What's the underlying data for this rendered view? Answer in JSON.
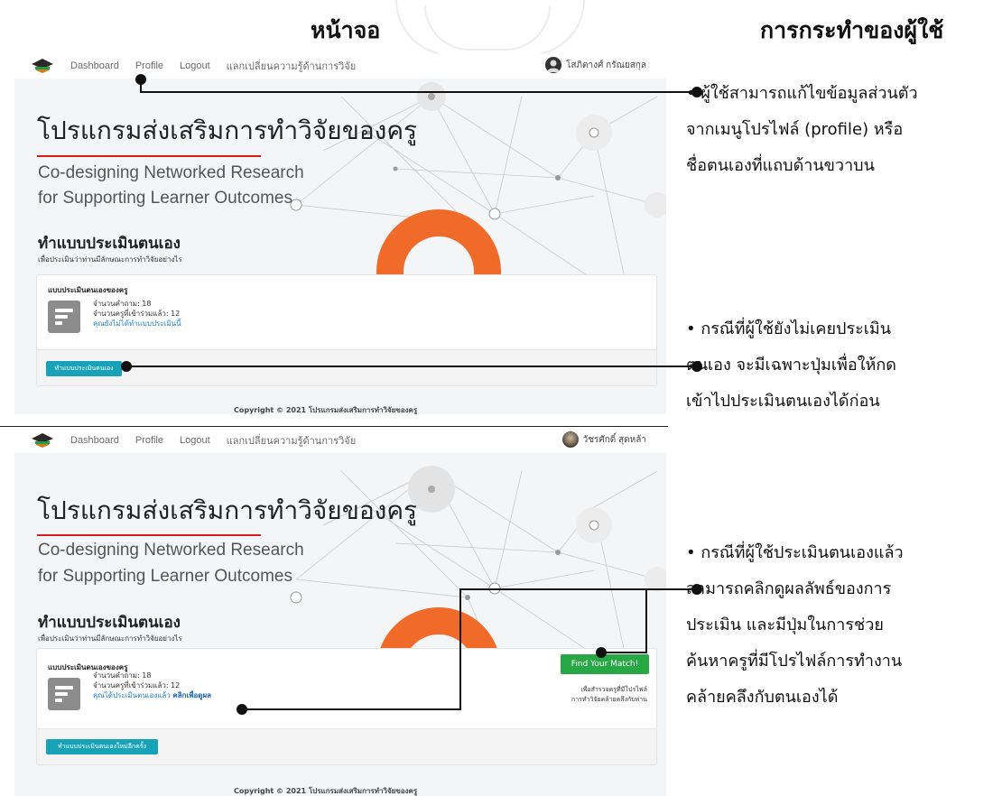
{
  "columns": {
    "screen_label": "หน้าจอ",
    "action_label": "การกระทำของผู้ใช้"
  },
  "screen1": {
    "nav": {
      "dashboard": "Dashboard",
      "profile": "Profile",
      "logout": "Logout",
      "exchange": "แลกเปลี่ยนความรู้ด้านการวิจัย",
      "user_name": "โสภิตางศ์ กรัณยสกุล"
    },
    "hero": {
      "title": "โปรแกรมส่งเสริมการทำวิจัยของครู",
      "subtitle_line1": "Co-designing Networked Research",
      "subtitle_line2": "for Supporting Learner Outcomes"
    },
    "section": {
      "title": "ทำแบบประเมินตนเอง",
      "subtitle": "เพื่อประเมินว่าท่านมีลักษณะการทำวิจัยอย่างไร"
    },
    "card": {
      "title": "แบบประเมินตนเองของครู",
      "questions": "จำนวนคำถาม: 18",
      "participants": "จำนวนครูที่เข้าร่วมแล้ว: 12",
      "status": "คุณยังไม่ได้ทำแบบประเมินนี้",
      "button": "ทำแบบประเมินตนเอง"
    },
    "copyright": "Copyright © 2021 โปรแกรมส่งเสริมการทำวิจัยของครู"
  },
  "screen2": {
    "nav": {
      "dashboard": "Dashboard",
      "profile": "Profile",
      "logout": "Logout",
      "exchange": "แลกเปลี่ยนความรู้ด้านการวิจัย",
      "user_name": "วัชรศักดิ์ สุดหล้า"
    },
    "hero": {
      "title": "โปรแกรมส่งเสริมการทำวิจัยของครู",
      "subtitle_line1": "Co-designing Networked Research",
      "subtitle_line2": "for Supporting Learner Outcomes"
    },
    "section": {
      "title": "ทำแบบประเมินตนเอง",
      "subtitle": "เพื่อประเมินว่าท่านมีลักษณะการทำวิจัยอย่างไร"
    },
    "card": {
      "title": "แบบประเมินตนเองของครู",
      "questions": "จำนวนคำถาม: 18",
      "participants": "จำนวนครูที่เข้าร่วมแล้ว: 12",
      "status_text": "คุณได้ประเมินตนเองแล้ว",
      "status_link": "คลิกเพื่อดูผล",
      "button": "ทำแบบประเมินตนเองใหม่อีกครั้ง",
      "match_button": "Find Your Match!",
      "match_note_line1": "เพื่อสำรวจครูที่มีโปรไฟล์",
      "match_note_line2": "การทำวิจัยคล้ายคลึงกับท่าน"
    },
    "copyright": "Copyright © 2021 โปรแกรมส่งเสริมการทำวิจัยของครู"
  },
  "annotations": {
    "a1": [
      "• ผู้ใช้สามารถแก้ไขข้อมูลส่วนตัว",
      "จากเมนูโปรไฟล์ (profile) หรือ",
      "ชื่อตนเองที่แถบด้านขวาบน"
    ],
    "a2": [
      "• กรณีที่ผู้ใช้ยังไม่เคยประเมิน",
      "ตนเอง จะมีเฉพาะปุ่มเพื่อให้กด",
      "เข้าไปประเมินตนเองได้ก่อน"
    ],
    "a3": [
      "• กรณีที่ผู้ใช้ประเมินตนเองแล้ว",
      "สามารถคลิกดูผลลัพธ์ของการ",
      "ประเมิน และมีปุ่มในการช่วย",
      "ค้นหาครูที่มีโปรไฟล์การทำงาน",
      "คล้ายคลึงกับตนเองได้"
    ]
  },
  "colors": {
    "accent_red": "#d91d1d",
    "button_teal": "#17a2b8",
    "button_green": "#28a745",
    "link_blue": "#1a7fd1",
    "orange": "#f06a2a"
  }
}
